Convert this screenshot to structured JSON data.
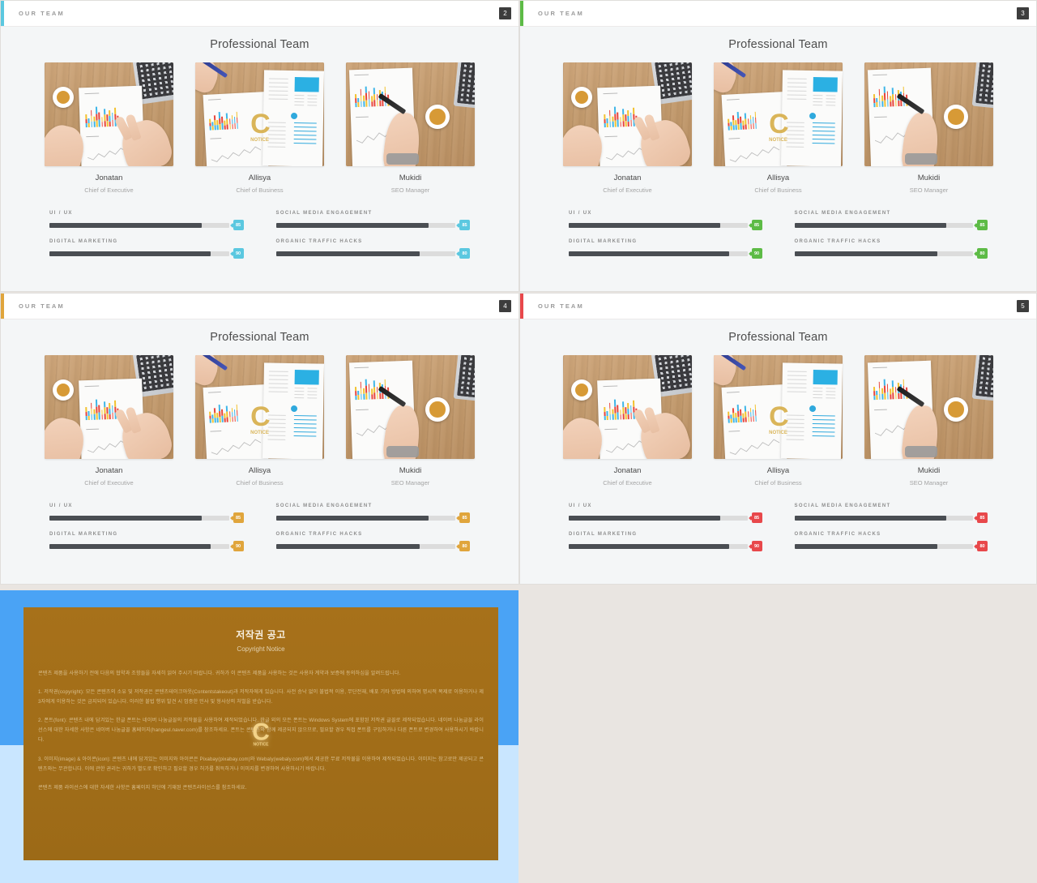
{
  "app": {
    "background_color": "#e9e5e1"
  },
  "slides": [
    {
      "header_label": "OUR TEAM",
      "page_number": "2",
      "title": "Professional Team",
      "accent_color": "#5bc8e0",
      "members": [
        {
          "name": "Jonatan",
          "role": "Chief of Executive",
          "photo_alt": "hands-on-desk-with-chart-report"
        },
        {
          "name": "Allisya",
          "role": "Chief of Business",
          "photo_alt": "hand-with-pen-and-resume-documents"
        },
        {
          "name": "Mukidi",
          "role": "SEO Manager",
          "photo_alt": "hand-writing-on-chart-with-coffee"
        }
      ],
      "skills_left": [
        {
          "label": "UI / UX",
          "value": 85,
          "value_text": "85"
        },
        {
          "label": "DIGITAL MARKETING",
          "value": 90,
          "value_text": "90"
        }
      ],
      "skills_right": [
        {
          "label": "SOCIAL MEDIA ENGAGEMENT",
          "value": 85,
          "value_text": "85"
        },
        {
          "label": "ORGANIC TRAFFIC HACKS",
          "value": 80,
          "value_text": "80"
        }
      ]
    },
    {
      "header_label": "OUR TEAM",
      "page_number": "3",
      "title": "Professional Team",
      "accent_color": "#5dbb46",
      "members": [
        {
          "name": "Jonatan",
          "role": "Chief of Executive",
          "photo_alt": "hands-on-desk-with-chart-report"
        },
        {
          "name": "Allisya",
          "role": "Chief of Business",
          "photo_alt": "hand-with-pen-and-resume-documents"
        },
        {
          "name": "Mukidi",
          "role": "SEO Manager",
          "photo_alt": "hand-writing-on-chart-with-coffee"
        }
      ],
      "skills_left": [
        {
          "label": "UI / UX",
          "value": 85,
          "value_text": "85"
        },
        {
          "label": "DIGITAL MARKETING",
          "value": 90,
          "value_text": "90"
        }
      ],
      "skills_right": [
        {
          "label": "SOCIAL MEDIA ENGAGEMENT",
          "value": 85,
          "value_text": "85"
        },
        {
          "label": "ORGANIC TRAFFIC HACKS",
          "value": 80,
          "value_text": "80"
        }
      ]
    },
    {
      "header_label": "OUR TEAM",
      "page_number": "4",
      "title": "Professional Team",
      "accent_color": "#e0a53c",
      "members": [
        {
          "name": "Jonatan",
          "role": "Chief of Executive",
          "photo_alt": "hands-on-desk-with-chart-report"
        },
        {
          "name": "Allisya",
          "role": "Chief of Business",
          "photo_alt": "hand-with-pen-and-resume-documents"
        },
        {
          "name": "Mukidi",
          "role": "SEO Manager",
          "photo_alt": "hand-writing-on-chart-with-coffee"
        }
      ],
      "skills_left": [
        {
          "label": "UI / UX",
          "value": 85,
          "value_text": "85"
        },
        {
          "label": "DIGITAL MARKETING",
          "value": 90,
          "value_text": "90"
        }
      ],
      "skills_right": [
        {
          "label": "SOCIAL MEDIA ENGAGEMENT",
          "value": 85,
          "value_text": "85"
        },
        {
          "label": "ORGANIC TRAFFIC HACKS",
          "value": 80,
          "value_text": "80"
        }
      ]
    },
    {
      "header_label": "OUR TEAM",
      "page_number": "5",
      "title": "Professional Team",
      "accent_color": "#e8484b",
      "members": [
        {
          "name": "Jonatan",
          "role": "Chief of Executive",
          "photo_alt": "hands-on-desk-with-chart-report"
        },
        {
          "name": "Allisya",
          "role": "Chief of Business",
          "photo_alt": "hand-with-pen-and-resume-documents"
        },
        {
          "name": "Mukidi",
          "role": "SEO Manager",
          "photo_alt": "hand-writing-on-chart-with-coffee"
        }
      ],
      "skills_left": [
        {
          "label": "UI / UX",
          "value": 85,
          "value_text": "85"
        },
        {
          "label": "DIGITAL MARKETING",
          "value": 90,
          "value_text": "90"
        }
      ],
      "skills_right": [
        {
          "label": "SOCIAL MEDIA ENGAGEMENT",
          "value": 85,
          "value_text": "85"
        },
        {
          "label": "ORGANIC TRAFFIC HACKS",
          "value": 80,
          "value_text": "80"
        }
      ]
    }
  ],
  "copyright": {
    "frame_color": "#4aa3f5",
    "panel_color": "#a7711a",
    "title": "저작권 공고",
    "subtitle": "Copyright Notice",
    "watermark": "C",
    "watermark_sub": "NOTICE",
    "paragraphs": [
      "콘텐츠 제품을 사용하기 전에 다음의 협약과 조항들을 자세히 읽어 주시기 바랍니다. 귀하가 이 콘텐츠 제품을 사용하는 것은 사용자 계약과 보증에 동의하심을 알려드립니다.",
      "1. 저작권(copyright): 모든 콘텐츠의 소유 및 저작권은 콘텐츠테이크아웃(Contentstakeout)과 저작자에게 있습니다. 사전 승낙 없이 불법적 이용, 무단전재, 배포 기타 방법에 의하여 명시적 복제로 이용하거나 제3자에게 이용하는 것은 금지되어 있습니다. 이러한 불법 행위 발견 시 엄중한 민사 및 형사상의 처벌을 받습니다.",
      "2. 폰트(font): 콘텐츠 내에 담겨있는 한글 폰트는 네이버 나눔글꼴의 저작물을 사용하여 제작되었습니다. 한글 외의 모든 폰트는 Windows System에 포함된 저작권 글꼴로 제작되었습니다. 네이버 나눔글꼴 라이선스에 대한 자세한 사항은 네이버 나눔글꼴 홈페이지(hangeul.naver.com)를 참조하세요. 폰트는 콘텐츠와 함께 제공되지 않으므로, 필요할 경우 직접 폰트를 구입하거나 다른 폰트로 변경하여 사용하시기 바랍니다.",
      "3. 이미지(image) & 아이콘(icon): 콘텐츠 내에 담겨있는 이미지와 아이콘은 Pixabay(pixabay.com)와 Webaly(webaly.com)에서 제공한 무료 저작물을 이용하여 제작되었습니다. 이미지는 참고로만 제공되고 콘텐츠와는 무관합니다. 이에 관한 권리는 귀하가 별도로 확인하고 필요할 경우 허가를 취득하거나 이미지를 변경하여 사용하시기 바랍니다.",
      "콘텐츠 제품 라이선스에 대한 자세한 사항은 홈페이지 하단에 기재된 콘텐츠라이선스를 참조하세요."
    ]
  }
}
